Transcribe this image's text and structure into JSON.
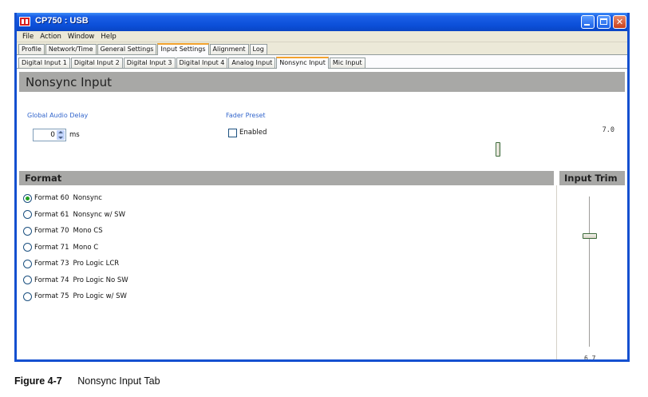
{
  "window": {
    "title": "CP750 : USB"
  },
  "menu": [
    "File",
    "Action",
    "Window",
    "Help"
  ],
  "main_tabs": [
    {
      "label": "Profile",
      "active": false
    },
    {
      "label": "Network/Time",
      "active": false
    },
    {
      "label": "General Settings",
      "active": false
    },
    {
      "label": "Input Settings",
      "active": true
    },
    {
      "label": "Alignment",
      "active": false
    },
    {
      "label": "Log",
      "active": false
    }
  ],
  "input_tabs": [
    {
      "label": "Digital Input 1",
      "active": false
    },
    {
      "label": "Digital Input 2",
      "active": false
    },
    {
      "label": "Digital Input 3",
      "active": false
    },
    {
      "label": "Digital Input 4",
      "active": false
    },
    {
      "label": "Analog Input",
      "active": false
    },
    {
      "label": "Nonsync Input",
      "active": true
    },
    {
      "label": "Mic Input",
      "active": false
    }
  ],
  "panel": {
    "title": "Nonsync Input",
    "global_audio_delay": {
      "label": "Global Audio Delay",
      "value": "0",
      "unit": "ms"
    },
    "fader_preset": {
      "label": "Fader Preset",
      "checkbox_label": "Enabled",
      "checked": false,
      "value": "7.0",
      "slider_fraction": 0.7
    }
  },
  "format": {
    "title": "Format",
    "options": [
      {
        "name": "Format 60",
        "desc": "Nonsync",
        "selected": true
      },
      {
        "name": "Format 61",
        "desc": "Nonsync w/ SW",
        "selected": false
      },
      {
        "name": "Format 70",
        "desc": "Mono CS",
        "selected": false
      },
      {
        "name": "Format 71",
        "desc": "Mono C",
        "selected": false
      },
      {
        "name": "Format 73",
        "desc": "Pro Logic LCR",
        "selected": false
      },
      {
        "name": "Format 74",
        "desc": "Pro Logic No SW",
        "selected": false
      },
      {
        "name": "Format 75",
        "desc": "Pro Logic w/ SW",
        "selected": false
      }
    ]
  },
  "input_trim": {
    "title": "Input Trim",
    "value": "6.7"
  },
  "caption": {
    "figure": "Figure 4-7",
    "text": "Nonsync Input Tab"
  }
}
